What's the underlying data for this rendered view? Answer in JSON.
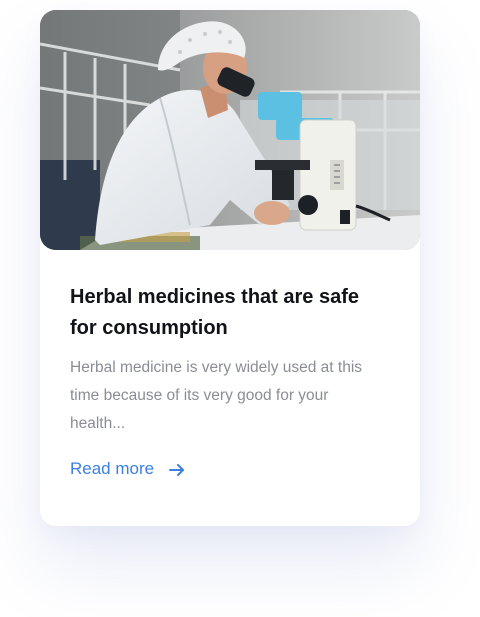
{
  "card": {
    "image_alt": "Lab researcher looking into a microscope",
    "title": "Herbal medicines that are safe for consumption",
    "excerpt": "Herbal medicine is very widely used at this time because of its very good for your health...",
    "read_more_label": "Read more",
    "read_more_icon": "arrow-right-icon",
    "accent_color": "#3d7fe0"
  }
}
